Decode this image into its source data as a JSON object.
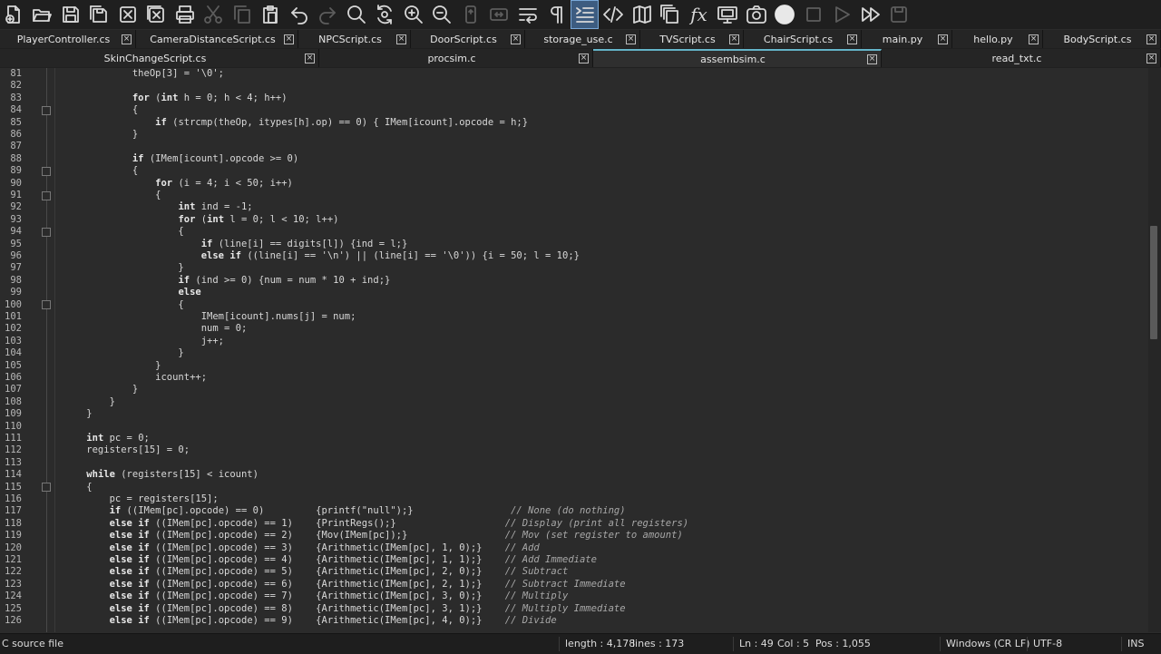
{
  "toolbar": {
    "buttons": [
      {
        "icon": "new-file-icon",
        "enabled": true
      },
      {
        "icon": "open-folder-icon",
        "enabled": true
      },
      {
        "icon": "save-icon",
        "enabled": true
      },
      {
        "icon": "save-all-icon",
        "enabled": true
      },
      {
        "icon": "close-icon",
        "enabled": true
      },
      {
        "icon": "close-all-icon",
        "enabled": true
      },
      {
        "icon": "print-icon",
        "enabled": true
      },
      {
        "icon": "cut-icon",
        "enabled": false
      },
      {
        "icon": "copy-icon",
        "enabled": false
      },
      {
        "icon": "paste-icon",
        "enabled": true
      },
      {
        "icon": "undo-icon",
        "enabled": true
      },
      {
        "icon": "redo-icon",
        "enabled": false
      },
      {
        "icon": "find-icon",
        "enabled": true
      },
      {
        "icon": "replace-icon",
        "enabled": true
      },
      {
        "icon": "zoom-in-icon",
        "enabled": true
      },
      {
        "icon": "zoom-out-icon",
        "enabled": true
      },
      {
        "icon": "sync-vertical-scroll-icon",
        "enabled": false
      },
      {
        "icon": "sync-horizontal-scroll-icon",
        "enabled": false
      },
      {
        "icon": "word-wrap-icon",
        "enabled": true
      },
      {
        "icon": "show-all-characters-icon",
        "enabled": true
      },
      {
        "icon": "indent-guide-icon",
        "enabled": true,
        "active": true
      },
      {
        "icon": "xml-tag-icon",
        "enabled": true
      },
      {
        "icon": "document-map-icon",
        "enabled": true
      },
      {
        "icon": "document-list-icon",
        "enabled": true
      },
      {
        "icon": "function-list-icon",
        "enabled": true
      },
      {
        "icon": "monitor-icon",
        "enabled": true
      },
      {
        "icon": "camera-icon",
        "enabled": true
      },
      {
        "icon": "record-macro-icon",
        "enabled": true
      },
      {
        "icon": "stop-macro-icon",
        "enabled": false
      },
      {
        "icon": "play-macro-icon",
        "enabled": false
      },
      {
        "icon": "run-macro-multiple-icon",
        "enabled": true
      },
      {
        "icon": "save-macro-icon",
        "enabled": false
      }
    ]
  },
  "tabs_row1": [
    {
      "label": "PlayerController.cs"
    },
    {
      "label": "CameraDistanceScript.cs"
    },
    {
      "label": "NPCScript.cs"
    },
    {
      "label": "DoorScript.cs"
    },
    {
      "label": "storage_use.c"
    },
    {
      "label": "TVScript.cs"
    },
    {
      "label": "ChairScript.cs"
    },
    {
      "label": "main.py"
    },
    {
      "label": "hello.py"
    },
    {
      "label": "BodyScript.cs"
    }
  ],
  "tabs_row2": [
    {
      "label": "SkinChangeScript.cs",
      "active": false
    },
    {
      "label": "procsim.c",
      "active": false
    },
    {
      "label": "assembsim.c",
      "active": true
    },
    {
      "label": "read_txt.c",
      "active": false
    }
  ],
  "tab_close_glyph": "×",
  "editor": {
    "first_line": 81,
    "lines": [
      "            theOp[3] = '\\0';",
      "",
      "            for (int h = 0; h < 4; h++)",
      "            {",
      "                if (strcmp(theOp, itypes[h].op) == 0) { IMem[icount].opcode = h;}",
      "            }",
      "",
      "            if (IMem[icount].opcode >= 0)",
      "            {",
      "                for (i = 4; i < 50; i++)",
      "                {",
      "                    int ind = -1;",
      "                    for (int l = 0; l < 10; l++)",
      "                    {",
      "                        if (line[i] == digits[l]) {ind = l;}",
      "                        else if ((line[i] == '\\n') || (line[i] == '\\0')) {i = 50; l = 10;}",
      "                    }",
      "                    if (ind >= 0) {num = num * 10 + ind;}",
      "                    else",
      "                    {",
      "                        IMem[icount].nums[j] = num;",
      "                        num = 0;",
      "                        j++;",
      "                    }",
      "                }",
      "                icount++;",
      "            }",
      "        }",
      "    }",
      "",
      "    int pc = 0;",
      "    registers[15] = 0;",
      "",
      "    while (registers[15] < icount)",
      "    {",
      "        pc = registers[15];",
      "        if ((IMem[pc].opcode) == 0)         {printf(\"null\");}                 // None (do nothing)",
      "        else if ((IMem[pc].opcode) == 1)    {PrintRegs();}                   // Display (print all registers)",
      "        else if ((IMem[pc].opcode) == 2)    {Mov(IMem[pc]);}                 // Mov (set register to amount)",
      "        else if ((IMem[pc].opcode) == 3)    {Arithmetic(IMem[pc], 1, 0);}    // Add",
      "        else if ((IMem[pc].opcode) == 4)    {Arithmetic(IMem[pc], 1, 1);}    // Add Immediate",
      "        else if ((IMem[pc].opcode) == 5)    {Arithmetic(IMem[pc], 2, 0);}    // Subtract",
      "        else if ((IMem[pc].opcode) == 6)    {Arithmetic(IMem[pc], 2, 1);}    // Subtract Immediate",
      "        else if ((IMem[pc].opcode) == 7)    {Arithmetic(IMem[pc], 3, 0);}    // Multiply",
      "        else if ((IMem[pc].opcode) == 8)    {Arithmetic(IMem[pc], 3, 1);}    // Multiply Immediate",
      "        else if ((IMem[pc].opcode) == 9)    {Arithmetic(IMem[pc], 4, 0);}    // Divide"
    ],
    "fold_markers_at_lines": [
      84,
      89,
      91,
      94,
      100,
      115
    ],
    "keywords": [
      "for",
      "int",
      "if",
      "else",
      "while"
    ],
    "scroll_fraction": 0.35
  },
  "status": {
    "file_type": "C source file",
    "length": "length : 4,178",
    "lines": "lines : 173",
    "ln": "Ln : 49",
    "col": "Col : 5",
    "pos": "Pos : 1,055",
    "eol": "Windows (CR LF)",
    "encoding": "UTF-8",
    "mode": "INS"
  },
  "colors": {
    "background": "#2b2b2b",
    "toolbar": "#1f1f1f",
    "active_tab_accent": "#64b4c8",
    "active_tool": "#3d5c80"
  }
}
